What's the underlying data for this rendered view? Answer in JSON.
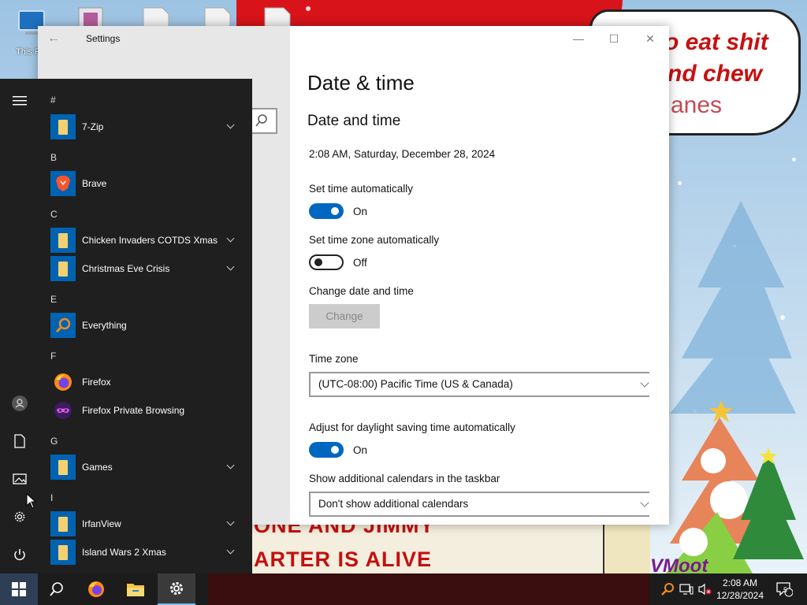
{
  "desktop": {
    "icons": [
      {
        "name": "this-pc",
        "label": "This P"
      },
      {
        "name": "shortcut",
        "label": ""
      },
      {
        "name": "file-1",
        "label": ""
      },
      {
        "name": "file-2",
        "label": ""
      },
      {
        "name": "file-3",
        "label": ""
      }
    ],
    "wallpaper": {
      "bubble_line1": "o eat shit",
      "bubble_line2": "nd chew",
      "bubble_line3": "anes",
      "bottom_line1": "ONE AND JIMMY",
      "bottom_line2": "ARTER IS ALIVE",
      "signature": "VMoot"
    }
  },
  "settings": {
    "window_title": "Settings",
    "page_title": "Date & time",
    "section_title": "Date and time",
    "current_datetime": "2:08 AM, Saturday, December 28, 2024",
    "set_time_auto": {
      "label": "Set time automatically",
      "state": "On"
    },
    "set_timezone_auto": {
      "label": "Set time zone automatically",
      "state": "Off"
    },
    "change_date": {
      "label": "Change date and time",
      "button": "Change"
    },
    "time_zone": {
      "label": "Time zone",
      "value": "(UTC-08:00) Pacific Time (US & Canada)"
    },
    "daylight": {
      "label": "Adjust for daylight saving time automatically",
      "state": "On"
    },
    "calendars": {
      "label": "Show additional calendars in the taskbar",
      "value": "Don't show additional calendars"
    }
  },
  "start_menu": {
    "groups": [
      {
        "letter": "#",
        "apps": [
          {
            "label": "7-Zip",
            "icon": "folder",
            "expandable": true
          }
        ]
      },
      {
        "letter": "B",
        "apps": [
          {
            "label": "Brave",
            "icon": "brave",
            "expandable": false
          }
        ]
      },
      {
        "letter": "C",
        "apps": [
          {
            "label": "Chicken Invaders COTDS Xmas",
            "icon": "folder",
            "expandable": true
          },
          {
            "label": "Christmas Eve Crisis",
            "icon": "folder",
            "expandable": true
          }
        ]
      },
      {
        "letter": "E",
        "apps": [
          {
            "label": "Everything",
            "icon": "everything",
            "expandable": false
          }
        ]
      },
      {
        "letter": "F",
        "apps": [
          {
            "label": "Firefox",
            "icon": "firefox",
            "expandable": false
          },
          {
            "label": "Firefox Private Browsing",
            "icon": "firefox-private",
            "expandable": false
          }
        ]
      },
      {
        "letter": "G",
        "apps": [
          {
            "label": "Games",
            "icon": "folder",
            "expandable": true
          }
        ]
      },
      {
        "letter": "I",
        "apps": [
          {
            "label": "IrfanView",
            "icon": "folder",
            "expandable": true
          },
          {
            "label": "Island Wars 2 Xmas",
            "icon": "folder",
            "expandable": true
          }
        ]
      }
    ]
  },
  "taskbar": {
    "time": "2:08 AM",
    "date": "12/28/2024",
    "notification_count": "5"
  },
  "colors": {
    "accent": "#0067c0",
    "start_bg": "#1f1f1f",
    "taskbar_bg": "#1c1c1c",
    "folder": "#f3d171",
    "tile": "#0063b1"
  }
}
